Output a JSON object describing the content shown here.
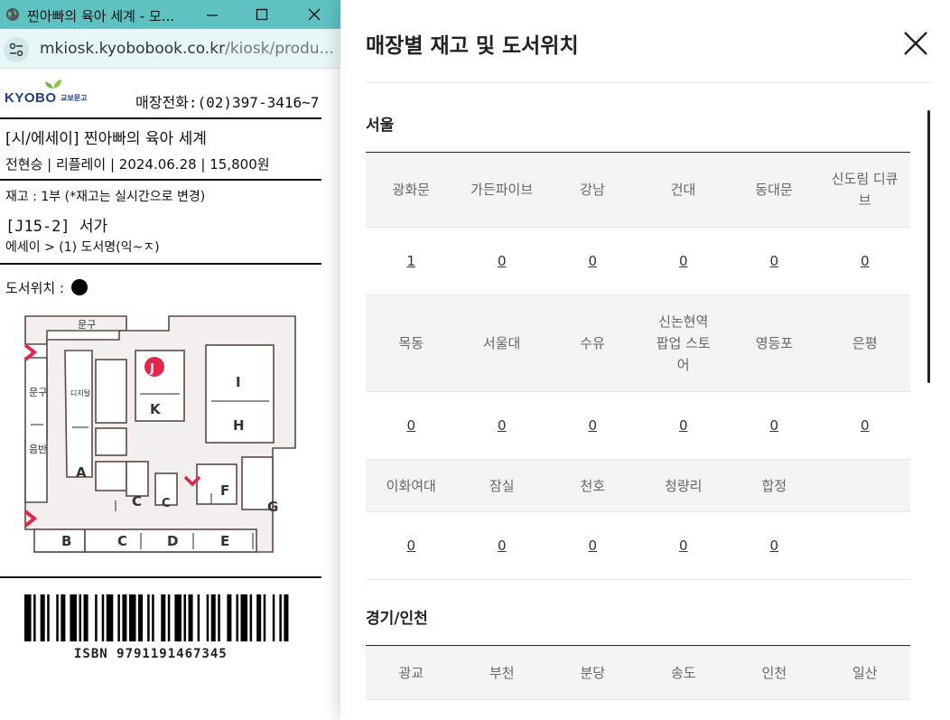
{
  "window": {
    "title": "찐아빠의 육아 세계 - 모...",
    "url_host": "mkiosk.kyobobook.co.kr",
    "url_path": "/kiosk/produ..."
  },
  "ticket": {
    "brand_en": "KYOBO",
    "brand_ko": "교보문고",
    "phone": "매장전화:(02)397-3416~7",
    "book_title": "[시/에세이] 찐아빠의 육아 세계",
    "book_meta": "전현승 | 리플레이 | 2024.06.28 | 15,800원",
    "stock": "재고 : 1부 (*재고는 실시간으로 변경)",
    "shelf_code": "[J15-2] 서가",
    "category": "에세이 > (1) 도서명(익~ㅈ)",
    "location_label": "도서위치 :",
    "isbn": "ISBN 9791191467345",
    "map_labels": {
      "mungu_top": "문구",
      "mungu_left": "문구",
      "eumban": "음반",
      "digital": "디지털",
      "I": "I",
      "H": "H",
      "K": "K",
      "J": "J",
      "A": "A",
      "B": "B",
      "C1": "C",
      "C2": "C",
      "C3": "C",
      "D": "D",
      "E": "E",
      "F": "F",
      "G": "G"
    }
  },
  "panel": {
    "title": "매장별 재고 및 도서위치",
    "regions": [
      {
        "name": "서울",
        "rows": [
          {
            "stores": [
              "광화문",
              "가든파이브",
              "강남",
              "건대",
              "동대문",
              "신도림 디큐브"
            ],
            "counts": [
              "1",
              "0",
              "0",
              "0",
              "0",
              "0"
            ]
          },
          {
            "stores": [
              "목동",
              "서울대",
              "수유",
              "신논현역 팝업 스토어",
              "영등포",
              "은평"
            ],
            "counts": [
              "0",
              "0",
              "0",
              "0",
              "0",
              "0"
            ]
          },
          {
            "stores": [
              "이화여대",
              "잠실",
              "천호",
              "청량리",
              "합정",
              ""
            ],
            "counts": [
              "0",
              "0",
              "0",
              "0",
              "0",
              ""
            ]
          }
        ]
      },
      {
        "name": "경기/인천",
        "rows": [
          {
            "stores": [
              "광교",
              "부천",
              "분당",
              "송도",
              "인천",
              "일산"
            ],
            "counts": []
          }
        ]
      }
    ]
  }
}
